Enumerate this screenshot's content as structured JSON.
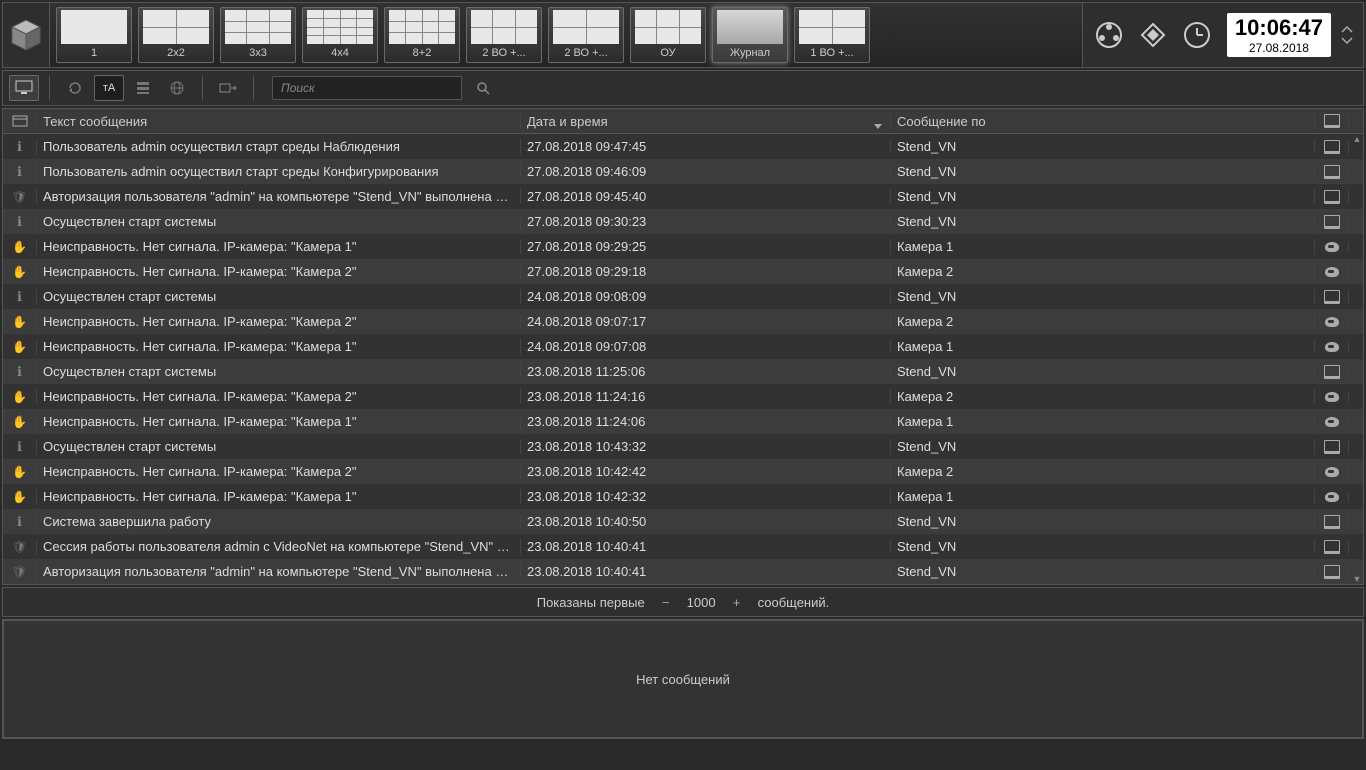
{
  "clock": {
    "time": "10:06:47",
    "date": "27.08.2018"
  },
  "layouts": [
    {
      "label": "1",
      "cols": 1,
      "rows": 1
    },
    {
      "label": "2x2",
      "cols": 2,
      "rows": 2
    },
    {
      "label": "3x3",
      "cols": 3,
      "rows": 3
    },
    {
      "label": "4x4",
      "cols": 4,
      "rows": 4
    },
    {
      "label": "8+2",
      "cols": 4,
      "rows": 3
    },
    {
      "label": "2 ВО +...",
      "cols": 3,
      "rows": 2
    },
    {
      "label": "2 ВО +...",
      "cols": 2,
      "rows": 2
    },
    {
      "label": "ОУ",
      "cols": 3,
      "rows": 2
    },
    {
      "label": "Журнал",
      "cols": 1,
      "rows": 1,
      "journal": true
    },
    {
      "label": "1 ВО +...",
      "cols": 2,
      "rows": 2
    }
  ],
  "active_layout_index": 8,
  "search": {
    "placeholder": "Поиск"
  },
  "columns": {
    "msg": "Текст сообщения",
    "date": "Дата и время",
    "src": "Сообщение по"
  },
  "rows": [
    {
      "icon": "info",
      "msg": "Пользователь admin осуществил старт среды Наблюдения",
      "date": "27.08.2018 09:47:45",
      "src": "Stend_VN",
      "dev": "monitor"
    },
    {
      "icon": "info",
      "msg": "Пользователь admin осуществил старт среды Конфигурирования",
      "date": "27.08.2018 09:46:09",
      "src": "Stend_VN",
      "dev": "monitor"
    },
    {
      "icon": "shield",
      "msg": "Авторизация пользователя \"admin\" на компьютере \"Stend_VN\" выполнена ус...",
      "date": "27.08.2018 09:45:40",
      "src": "Stend_VN",
      "dev": "monitor"
    },
    {
      "icon": "info",
      "msg": "Осуществлен старт системы",
      "date": "27.08.2018 09:30:23",
      "src": "Stend_VN",
      "dev": "monitor"
    },
    {
      "icon": "hand",
      "msg": "Неисправность. Нет сигнала. IP-камера: \"Камера 1\"",
      "date": "27.08.2018 09:29:25",
      "src": "Камера 1",
      "dev": "cam"
    },
    {
      "icon": "hand",
      "msg": "Неисправность. Нет сигнала. IP-камера: \"Камера 2\"",
      "date": "27.08.2018 09:29:18",
      "src": "Камера 2",
      "dev": "cam"
    },
    {
      "icon": "info",
      "msg": "Осуществлен старт системы",
      "date": "24.08.2018 09:08:09",
      "src": "Stend_VN",
      "dev": "monitor"
    },
    {
      "icon": "hand",
      "msg": "Неисправность. Нет сигнала. IP-камера: \"Камера 2\"",
      "date": "24.08.2018 09:07:17",
      "src": "Камера 2",
      "dev": "cam"
    },
    {
      "icon": "hand",
      "msg": "Неисправность. Нет сигнала. IP-камера: \"Камера 1\"",
      "date": "24.08.2018 09:07:08",
      "src": "Камера 1",
      "dev": "cam"
    },
    {
      "icon": "info",
      "msg": "Осуществлен старт системы",
      "date": "23.08.2018 11:25:06",
      "src": "Stend_VN",
      "dev": "monitor"
    },
    {
      "icon": "hand",
      "msg": "Неисправность. Нет сигнала. IP-камера: \"Камера 2\"",
      "date": "23.08.2018 11:24:16",
      "src": "Камера 2",
      "dev": "cam"
    },
    {
      "icon": "hand",
      "msg": "Неисправность. Нет сигнала. IP-камера: \"Камера 1\"",
      "date": "23.08.2018 11:24:06",
      "src": "Камера 1",
      "dev": "cam"
    },
    {
      "icon": "info",
      "msg": "Осуществлен старт системы",
      "date": "23.08.2018 10:43:32",
      "src": "Stend_VN",
      "dev": "monitor"
    },
    {
      "icon": "hand",
      "msg": "Неисправность. Нет сигнала. IP-камера: \"Камера 2\"",
      "date": "23.08.2018 10:42:42",
      "src": "Камера 2",
      "dev": "cam"
    },
    {
      "icon": "hand",
      "msg": "Неисправность. Нет сигнала. IP-камера: \"Камера 1\"",
      "date": "23.08.2018 10:42:32",
      "src": "Камера 1",
      "dev": "cam"
    },
    {
      "icon": "info",
      "msg": "Система завершила работу",
      "date": "23.08.2018 10:40:50",
      "src": "Stend_VN",
      "dev": "monitor"
    },
    {
      "icon": "shield",
      "msg": "Сессия работы пользователя admin с VideoNet на компьютере \"Stend_VN\" за...",
      "date": "23.08.2018 10:40:41",
      "src": "Stend_VN",
      "dev": "monitor"
    },
    {
      "icon": "shield",
      "msg": "Авторизация пользователя \"admin\" на компьютере \"Stend_VN\" выполнена ус...",
      "date": "23.08.2018 10:40:41",
      "src": "Stend_VN",
      "dev": "monitor"
    }
  ],
  "pager": {
    "prefix": "Показаны первые",
    "count": "1000",
    "suffix": "сообщений."
  },
  "bottom_msg": "Нет сообщений"
}
